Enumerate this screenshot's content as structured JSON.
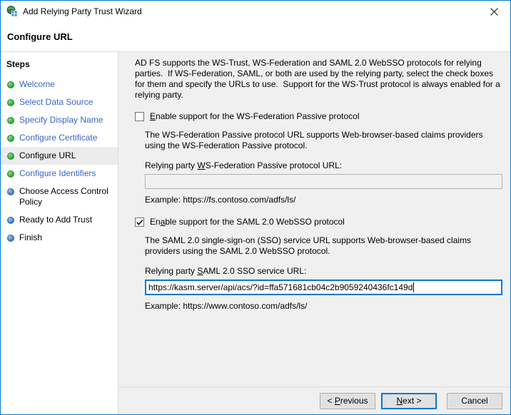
{
  "window": {
    "title": "Add Relying Party Trust Wizard",
    "close_icon": "✕"
  },
  "header": {
    "title": "Configure URL"
  },
  "sidebar": {
    "title": "Steps",
    "items": [
      {
        "label": "Welcome",
        "status": "done"
      },
      {
        "label": "Select Data Source",
        "status": "done"
      },
      {
        "label": "Specify Display Name",
        "status": "done"
      },
      {
        "label": "Configure Certificate",
        "status": "done"
      },
      {
        "label": "Configure URL",
        "status": "current"
      },
      {
        "label": "Configure Identifiers",
        "status": "done"
      },
      {
        "label": "Choose Access Control Policy",
        "status": "upcoming"
      },
      {
        "label": "Ready to Add Trust",
        "status": "upcoming"
      },
      {
        "label": "Finish",
        "status": "upcoming"
      }
    ]
  },
  "main": {
    "intro": "AD FS supports the WS-Trust, WS-Federation and SAML 2.0 WebSSO protocols for relying parties.  If WS-Federation, SAML, or both are used by the relying party, select the check boxes for them and specify the URLs to use.  Support for the WS-Trust protocol is always enabled for a relying party.",
    "wsfed": {
      "checked": false,
      "checkbox_label": {
        "pre": "",
        "accel": "E",
        "post": "nable support for the WS-Federation Passive protocol"
      },
      "description": "The WS-Federation Passive protocol URL supports Web-browser-based claims providers using the WS-Federation Passive protocol.",
      "url_label": {
        "pre": "Relying party ",
        "accel": "W",
        "post": "S-Federation Passive protocol URL:"
      },
      "url_value": "",
      "example": "Example: https://fs.contoso.com/adfs/ls/"
    },
    "saml": {
      "checked": true,
      "checkbox_label": {
        "pre": "En",
        "accel": "a",
        "post": "ble support for the SAML 2.0 WebSSO protocol"
      },
      "description": "The SAML 2.0 single-sign-on (SSO) service URL supports Web-browser-based claims providers using the SAML 2.0 WebSSO protocol.",
      "url_label": {
        "pre": "Relying party ",
        "accel": "S",
        "post": "AML 2.0 SSO service URL:"
      },
      "url_value": "https://kasm.server/api/acs/?id=ffa571681cb04c2b9059240436fc149d",
      "example": "Example: https://www.contoso.com/adfs/ls/"
    }
  },
  "footer": {
    "previous": {
      "pre": "< ",
      "accel": "P",
      "post": "revious"
    },
    "next": {
      "pre": "",
      "accel": "N",
      "post": "ext >"
    },
    "cancel": "Cancel"
  },
  "colors": {
    "accent_blue": "#0078d7",
    "link_blue": "#3b64c4",
    "done_dot_green": "#2f9e2f",
    "pending_dot_blue": "#3c71ae",
    "panel_gray": "#f0f0f0",
    "button_face": "#e1e1e1",
    "separator": "#dcdcdc",
    "current_step_highlight": "#ececec"
  }
}
